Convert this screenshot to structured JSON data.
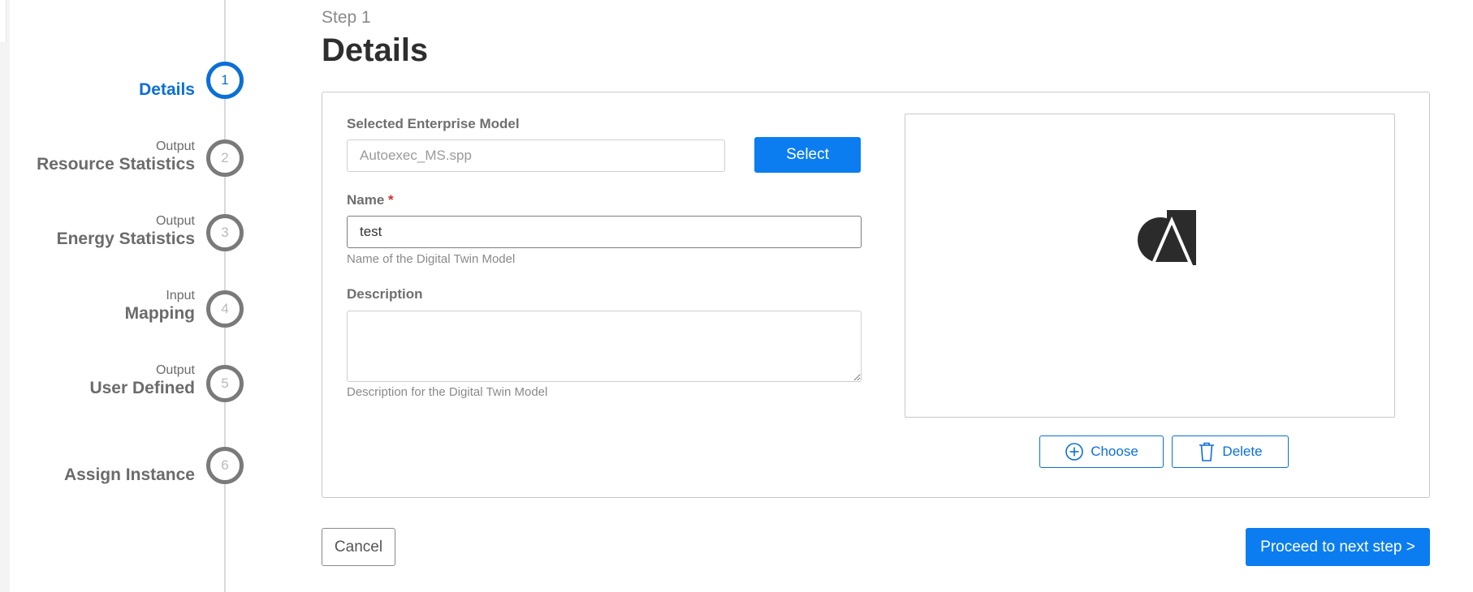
{
  "stepper": {
    "steps": [
      {
        "number": "1",
        "sub": "",
        "label": "Details",
        "state": "active"
      },
      {
        "number": "2",
        "sub": "Output",
        "label": "Resource Statistics",
        "state": "pending"
      },
      {
        "number": "3",
        "sub": "Output",
        "label": "Energy Statistics",
        "state": "pending"
      },
      {
        "number": "4",
        "sub": "Input",
        "label": "Mapping",
        "state": "pending"
      },
      {
        "number": "5",
        "sub": "Output",
        "label": "User Defined",
        "state": "pending"
      },
      {
        "number": "6",
        "sub": "",
        "label": "Assign Instance",
        "state": "pending"
      }
    ]
  },
  "header": {
    "step": "Step 1",
    "title": "Details"
  },
  "form": {
    "enterprise_model": {
      "label": "Selected Enterprise Model",
      "value": "Autoexec_MS.spp",
      "button": "Select"
    },
    "name": {
      "label": "Name",
      "required_mark": "*",
      "value": "test",
      "helper": "Name of the Digital Twin Model"
    },
    "description": {
      "label": "Description",
      "value": "",
      "helper": "Description for the Digital Twin Model"
    }
  },
  "image": {
    "choose_label": "Choose",
    "delete_label": "Delete",
    "icon": "shapes-logo-icon"
  },
  "footer": {
    "cancel_label": "Cancel",
    "proceed_label": "Proceed to next step >"
  },
  "colors": {
    "accent": "#0b7df0",
    "active_step": "#0b6fd6",
    "required": "#d0312d"
  }
}
